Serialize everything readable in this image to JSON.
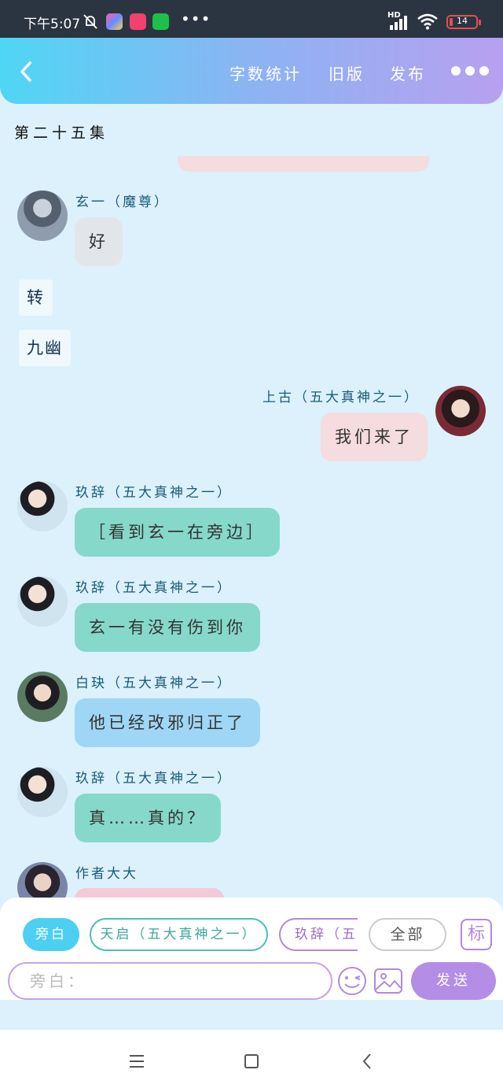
{
  "status_bar": {
    "time": "下午5:07",
    "network": "HD",
    "battery": "14",
    "battery_color": "#e05050"
  },
  "header": {
    "word_count": "字数统计",
    "old_version": "旧版",
    "publish": "发布"
  },
  "episode_title": "第二十五集",
  "messages": [
    {
      "speaker": "玄一（魔尊）",
      "text": "好",
      "side": "left",
      "color": "#e2e6eb"
    },
    {
      "note": "转"
    },
    {
      "note": "九幽"
    },
    {
      "speaker": "上古（五大真神之一）",
      "text": "我们来了",
      "side": "right",
      "color": "#f4dcdf"
    },
    {
      "speaker": "玖辞（五大真神之一）",
      "text": "［看到玄一在旁边］",
      "side": "left",
      "color": "#86d8cb"
    },
    {
      "speaker": "玖辞（五大真神之一）",
      "text": "玄一有没有伤到你",
      "side": "left",
      "color": "#86d8cb"
    },
    {
      "speaker": "白玦（五大真神之一）",
      "text": "他已经改邪归正了",
      "side": "left",
      "color": "#9fd6f6"
    },
    {
      "speaker": "玖辞（五大真神之一）",
      "text": "真……真的？",
      "side": "left",
      "color": "#86d8cb"
    },
    {
      "speaker": "作者大大",
      "text": "",
      "side": "left",
      "color": "#f4c9d8"
    }
  ],
  "role_chips": {
    "narration": "旁白",
    "tianqi": "天启（五大真神之一）",
    "jiuci": "玖辞（五大真神之一）",
    "all": "全部",
    "mark": "标"
  },
  "input": {
    "placeholder": "旁白："
  },
  "send": "发送",
  "icons": [
    "back-icon",
    "more-icon",
    "emoji-icon",
    "image-icon",
    "menu-icon",
    "home-icon",
    "nav-back-icon"
  ]
}
